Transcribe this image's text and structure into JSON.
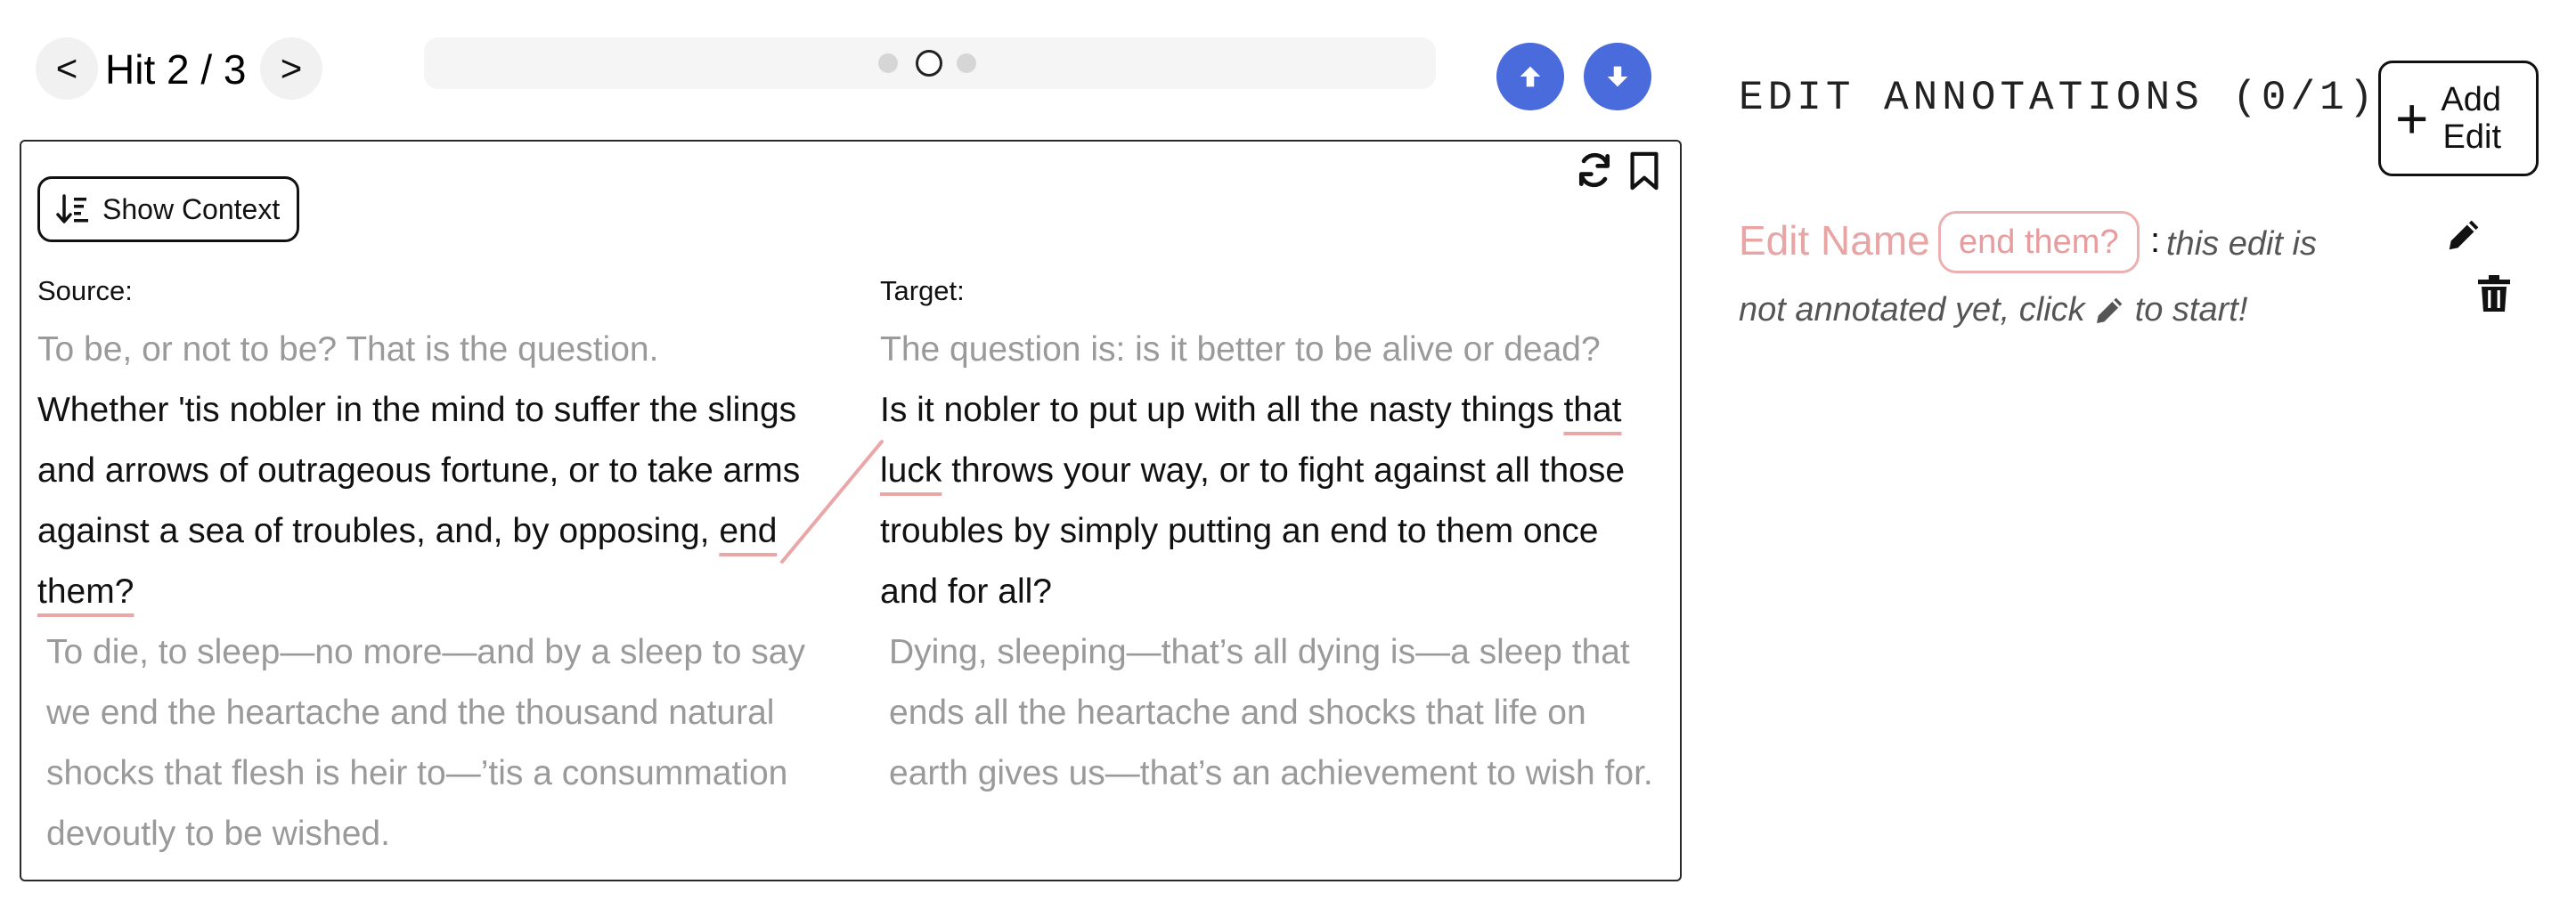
{
  "navigation": {
    "prev_label": "<",
    "next_label": ">",
    "hit_label": "Hit 2 / 3"
  },
  "panel": {
    "show_context_label": "Show Context",
    "source_label": "Source:",
    "target_label": "Target:",
    "source": {
      "context_before": "To be, or not to be? That is the question.",
      "main_before": "Whether 'tis nobler in the mind to suffer the slings and arrows of outrageous fortune, or to take arms against a sea of troubles, and, by opposing, ",
      "main_highlight": "end them?",
      "context_after": "To die, to sleep—no more—and by a sleep to say we end the heartache and the thousand natural shocks that flesh is heir to—’tis a consummation devoutly to be wished."
    },
    "target": {
      "context_before": "The question is: is it better to be alive or dead?",
      "main_before": "Is it nobler to put up with all the nasty things ",
      "main_highlight": "that luck",
      "main_after": " throws your way, or to fight against all those troubles by simply putting an end to them once and for all?",
      "context_after": "Dying, sleeping—that’s all dying is—a sleep that ends all the heartache and shocks that life on earth gives us—that’s an achievement to wish for."
    }
  },
  "annotations": {
    "title": "EDIT ANNOTATIONS (0/1)",
    "add_label_line1": "Add",
    "add_label_line2": "Edit",
    "edit": {
      "name": "Edit Name",
      "chip": "end them?",
      "colon": ":",
      "note_part1": "this edit is",
      "note_part2": "not annotated yet, click",
      "note_part3": "to start!"
    }
  },
  "colors": {
    "accent_blue": "#4a6bdc",
    "highlight_pink": "#e9a7a8",
    "muted_text": "#9a9a9a"
  },
  "icons": [
    "chevron-left-icon",
    "chevron-right-icon",
    "arrow-up-icon",
    "arrow-down-icon",
    "sort-icon",
    "refresh-icon",
    "bookmark-icon",
    "plus-icon",
    "pencil-icon",
    "trash-icon"
  ]
}
